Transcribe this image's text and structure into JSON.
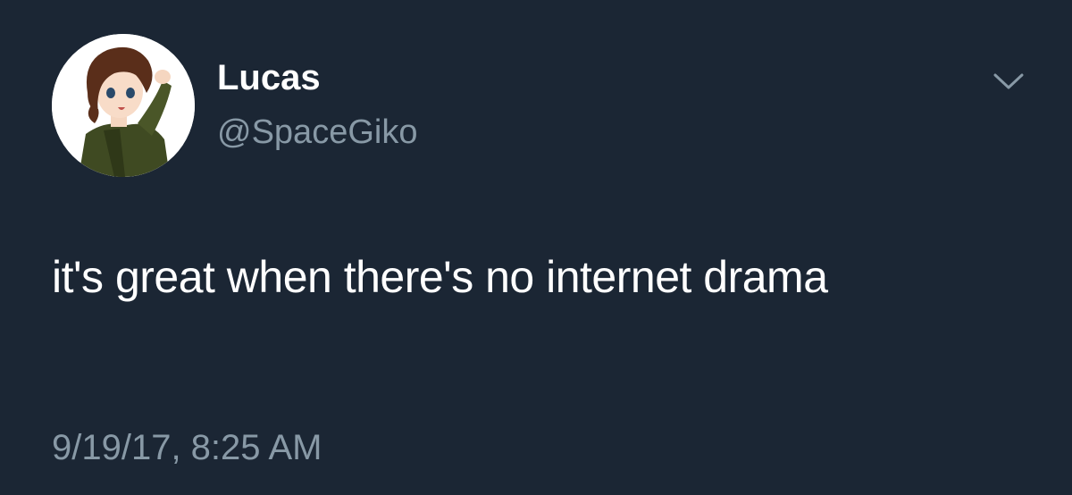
{
  "author": {
    "display_name": "Lucas",
    "handle": "@SpaceGiko",
    "avatar_icon": "anime-character-avatar"
  },
  "tweet": {
    "text": "it's great when there's no internet drama",
    "timestamp": "9/19/17, 8:25 AM"
  },
  "icons": {
    "menu": "chevron-down-icon"
  },
  "colors": {
    "background": "#1b2634",
    "primary_text": "#ffffff",
    "secondary_text": "#8899a6"
  }
}
